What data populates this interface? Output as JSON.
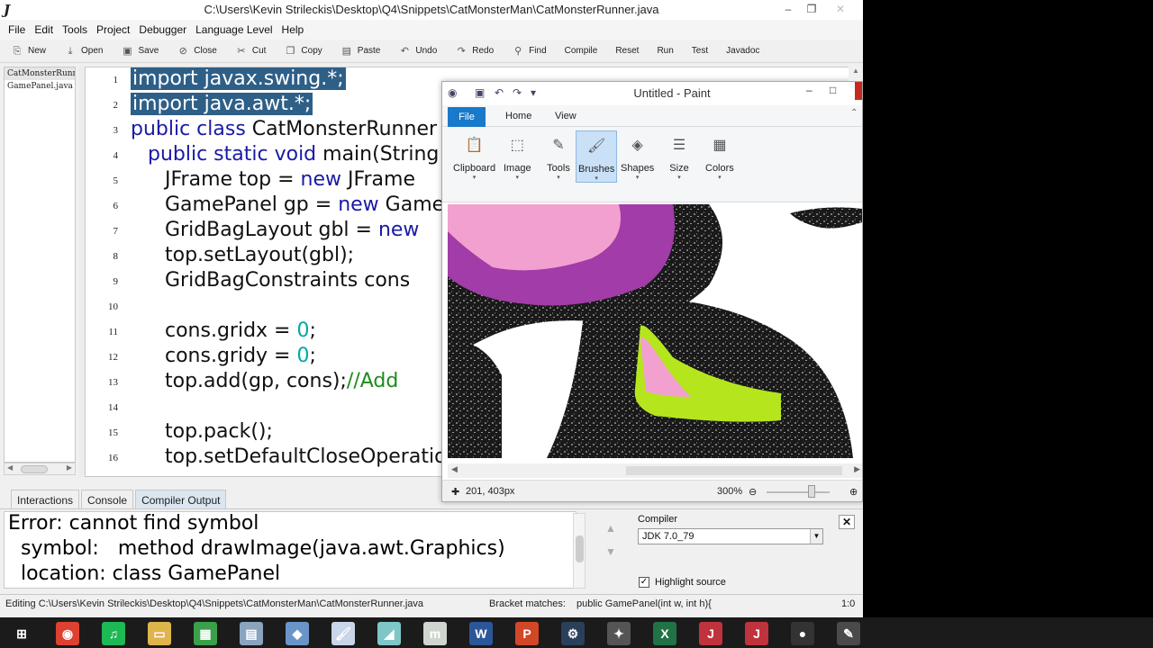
{
  "drjava": {
    "title": "C:\\Users\\Kevin Strileckis\\Desktop\\Q4\\Snippets\\CatMonsterMan\\CatMonsterRunner.java",
    "app_icon": "J",
    "menu": [
      "File",
      "Edit",
      "Tools",
      "Project",
      "Debugger",
      "Language Level",
      "Help"
    ],
    "toolbar": [
      {
        "label": "New",
        "icon": "new-file-icon",
        "glyph": "⎘"
      },
      {
        "label": "Open",
        "icon": "open-icon",
        "glyph": "⤓"
      },
      {
        "label": "Save",
        "icon": "save-icon",
        "glyph": "▣"
      },
      {
        "label": "Close",
        "icon": "close-file-icon",
        "glyph": "⊘"
      },
      {
        "label": "Cut",
        "icon": "scissors-icon",
        "glyph": "✂"
      },
      {
        "label": "Copy",
        "icon": "copy-icon",
        "glyph": "❐"
      },
      {
        "label": "Paste",
        "icon": "paste-icon",
        "glyph": "▤"
      },
      {
        "label": "Undo",
        "icon": "undo-icon",
        "glyph": "↶"
      },
      {
        "label": "Redo",
        "icon": "redo-icon",
        "glyph": "↷"
      },
      {
        "label": "Find",
        "icon": "binoculars-icon",
        "glyph": "⚲"
      },
      {
        "label": "Compile",
        "icon": "",
        "glyph": ""
      },
      {
        "label": "Reset",
        "icon": "",
        "glyph": ""
      },
      {
        "label": "Run",
        "icon": "",
        "glyph": ""
      },
      {
        "label": "Test",
        "icon": "",
        "glyph": ""
      },
      {
        "label": "Javadoc",
        "icon": "",
        "glyph": ""
      }
    ],
    "files": [
      "CatMonsterRunner.java",
      "GamePanel.java"
    ],
    "line_numbers": [
      "1",
      "2",
      "3",
      "4",
      "5",
      "6",
      "7",
      "8",
      "9",
      "10",
      "11",
      "12",
      "13",
      "14",
      "15",
      "16"
    ],
    "code": {
      "l1": "import javax.swing.*;",
      "l2": "import java.awt.*;",
      "l3a": "public class ",
      "l3b": "CatMonsterRunner",
      "l4a": "public static void ",
      "l4b": "main(String",
      "l5a": "JFrame top = ",
      "l5b": "new ",
      "l5c": "JFrame",
      "l6a": "GamePanel gp = ",
      "l6b": "new ",
      "l6c": "GamePanel",
      "l7a": "GridBagLayout gbl = ",
      "l7b": "new",
      "l8": "top.setLayout(gbl);",
      "l9": "GridBagConstraints cons",
      "l11a": "cons.gridx = ",
      "l11b": "0",
      "l11c": ";",
      "l12a": "cons.gridy = ",
      "l12b": "0",
      "l12c": ";",
      "l13a": "top.add(gp, cons);",
      "l13b": "//Add",
      "l15": "top.pack();",
      "l16": "top.setDefaultCloseOperation"
    },
    "tabs": [
      "Interactions",
      "Console",
      "Compiler Output"
    ],
    "output": {
      "line1": "Error: cannot find symbol",
      "line2": "  symbol:   method drawImage(java.awt.Graphics)",
      "line3": "  location: class GamePanel"
    },
    "compiler": {
      "label": "Compiler",
      "selected": "JDK 7.0_79",
      "highlight_label": "Highlight source",
      "highlight_checked": true
    },
    "status": {
      "editing": "Editing C:\\Users\\Kevin Strileckis\\Desktop\\Q4\\Snippets\\CatMonsterMan\\CatMonsterRunner.java",
      "bracket_label": "Bracket matches:",
      "bracket_value": "public GamePanel(int w, int h){",
      "position": "1:0"
    }
  },
  "paint": {
    "title": "Untitled - Paint",
    "tabs": {
      "file": "File",
      "home": "Home",
      "view": "View"
    },
    "ribbon": [
      {
        "label": "Clipboard",
        "icon": "clipboard-icon",
        "glyph": "📋"
      },
      {
        "label": "Image",
        "icon": "select-icon",
        "glyph": "⬚"
      },
      {
        "label": "Tools",
        "icon": "tools-icon",
        "glyph": "✎"
      },
      {
        "label": "Brushes",
        "icon": "brush-icon",
        "glyph": "🖌"
      },
      {
        "label": "Shapes",
        "icon": "shapes-icon",
        "glyph": "◈"
      },
      {
        "label": "Size",
        "icon": "size-icon",
        "glyph": "☰"
      },
      {
        "label": "Colors",
        "icon": "colors-icon",
        "glyph": "▦"
      }
    ],
    "cursor_pos": "201, 403px",
    "zoom": "300%"
  },
  "taskbar": {
    "icons": [
      {
        "name": "start-icon",
        "glyph": "⊞",
        "color": "#1b1b1b"
      },
      {
        "name": "chrome-icon",
        "glyph": "◉",
        "color": "#de4032"
      },
      {
        "name": "spotify-icon",
        "glyph": "♫",
        "color": "#1db954"
      },
      {
        "name": "file-explorer-icon",
        "glyph": "▭",
        "color": "#e0b44c"
      },
      {
        "name": "colorful-app-icon",
        "glyph": "▦",
        "color": "#3aa14a"
      },
      {
        "name": "calculator-icon",
        "glyph": "▤",
        "color": "#8aa4c0"
      },
      {
        "name": "box-app-icon",
        "glyph": "◆",
        "color": "#6b95c8"
      },
      {
        "name": "paint-icon",
        "glyph": "🖌",
        "color": "#c9d5e8"
      },
      {
        "name": "notepad-icon",
        "glyph": "◢",
        "color": "#7fc7c7"
      },
      {
        "name": "mu-icon",
        "glyph": "m",
        "color": "#cfd6cf"
      },
      {
        "name": "word-icon",
        "glyph": "W",
        "color": "#2b579a"
      },
      {
        "name": "powerpoint-icon",
        "glyph": "P",
        "color": "#d24726"
      },
      {
        "name": "steam-icon",
        "glyph": "⚙",
        "color": "#2a3f5a"
      },
      {
        "name": "game-icon",
        "glyph": "✦",
        "color": "#555555"
      },
      {
        "name": "excel-icon",
        "glyph": "X",
        "color": "#217346"
      },
      {
        "name": "drjava-icon-1",
        "glyph": "J",
        "color": "#c0333c"
      },
      {
        "name": "drjava-icon-2",
        "glyph": "J",
        "color": "#c0333c"
      },
      {
        "name": "obs-icon",
        "glyph": "●",
        "color": "#333333"
      },
      {
        "name": "paint-active-icon",
        "glyph": "✎",
        "color": "#4a4a4a"
      }
    ]
  }
}
